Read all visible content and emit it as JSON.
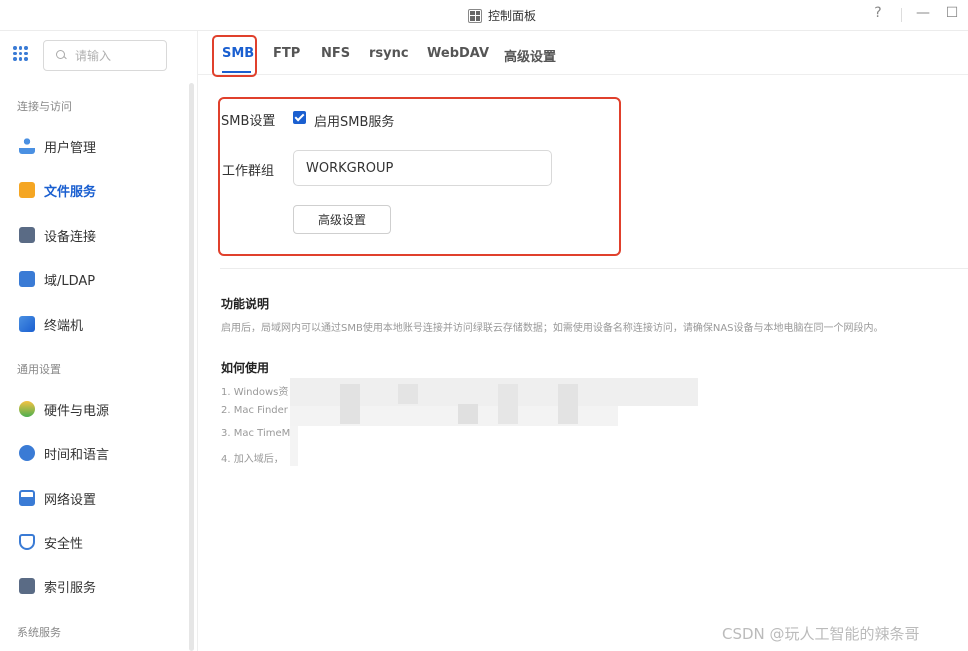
{
  "window": {
    "title": "控制面板",
    "help": "?",
    "minimize": "—",
    "maximize": "☐"
  },
  "sidebar": {
    "search_placeholder": "请输入",
    "groups": [
      {
        "label": "连接与访问"
      },
      {
        "label": "通用设置"
      },
      {
        "label": "系统服务"
      }
    ],
    "items": [
      {
        "label": "用户管理",
        "icon": "users-icon"
      },
      {
        "label": "文件服务",
        "icon": "folder-icon",
        "active": true
      },
      {
        "label": "设备连接",
        "icon": "device-icon"
      },
      {
        "label": "域/LDAP",
        "icon": "domain-icon"
      },
      {
        "label": "终端机",
        "icon": "terminal-icon"
      },
      {
        "label": "硬件与电源",
        "icon": "power-icon"
      },
      {
        "label": "时间和语言",
        "icon": "clock-icon"
      },
      {
        "label": "网络设置",
        "icon": "network-icon"
      },
      {
        "label": "安全性",
        "icon": "shield-icon"
      },
      {
        "label": "索引服务",
        "icon": "index-icon"
      }
    ]
  },
  "tabs": [
    {
      "label": "SMB",
      "active": true
    },
    {
      "label": "FTP"
    },
    {
      "label": "NFS"
    },
    {
      "label": "rsync"
    },
    {
      "label": "WebDAV"
    },
    {
      "label": "高级设置"
    }
  ],
  "smb": {
    "settings_label": "SMB设置",
    "enable_label": "启用SMB服务",
    "enabled": true,
    "workgroup_label": "工作群组",
    "workgroup_value": "WORKGROUP",
    "advanced_button": "高级设置"
  },
  "function": {
    "title": "功能说明",
    "text": "启用后，局域网内可以通过SMB使用本地账号连接并访问绿联云存储数据；如需使用设备名称连接访问，请确保NAS设备与本地电脑在同一个网段内。"
  },
  "howto": {
    "title": "如何使用",
    "items": [
      "1. Windows资",
      "2. Mac Finder",
      "3. Mac TimeM",
      "4. 加入域后，"
    ]
  },
  "watermark": "CSDN @玩人工智能的辣条哥",
  "colors": {
    "accent": "#1a5fd0",
    "highlight": "#e0402c"
  }
}
